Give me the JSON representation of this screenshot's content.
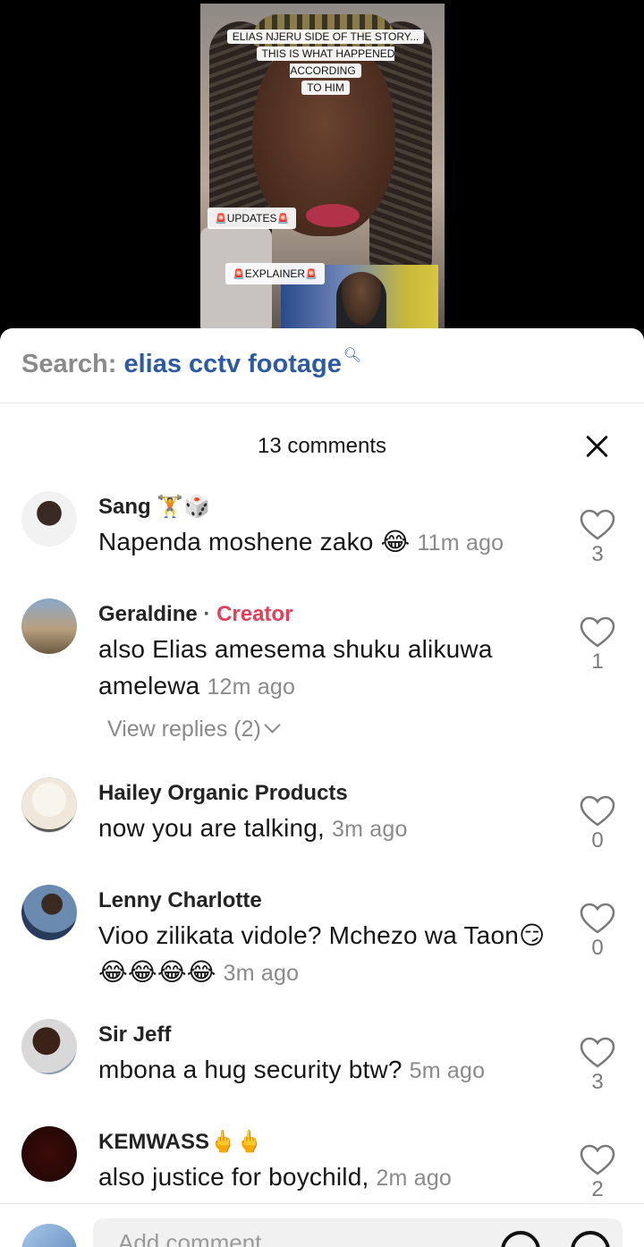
{
  "video": {
    "title_lines": [
      "ELIAS NJERU SIDE OF THE STORY...",
      "THIS IS WHAT HAPPENED ACCORDING",
      "TO HIM"
    ],
    "updates_label": "UPDATES",
    "explainer_label": "EXPLAINER",
    "siren": "🚨"
  },
  "search": {
    "prefix": "Search:",
    "term": "elias cctv footage",
    "icon": "search-icon"
  },
  "comments_header": {
    "count_label": "13 comments"
  },
  "comments": [
    {
      "name": "Sang",
      "name_extra": "🏋️🎲",
      "text": "Napenda moshene zako 😂",
      "time": "11m ago",
      "likes": "3"
    },
    {
      "name": "Geraldine",
      "badge": "Creator",
      "text": "also Elias amesema shuku alikuwa amelewa",
      "time": "12m ago",
      "likes": "1",
      "view_replies": "View replies (2)"
    },
    {
      "name": "Hailey Organic Products",
      "text": "now you are talking,",
      "time": "3m ago",
      "likes": "0"
    },
    {
      "name": "Lenny Charlotte",
      "text": "Vioo zilikata vidole? Mchezo wa Taon😏😂😂😂😂",
      "time": "3m ago",
      "likes": "0"
    },
    {
      "name": "Sir Jeff",
      "text": "mbona a hug security btw?",
      "time": "5m ago",
      "likes": "3"
    },
    {
      "name": "KEMWASS",
      "name_extra": "🖕🖕",
      "text": "also justice for boychild,",
      "time": "2m ago",
      "likes": "2"
    }
  ],
  "input": {
    "placeholder": "Add comment..."
  },
  "colors": {
    "creator": "#e0405c",
    "search_term": "#2d5aa0",
    "muted": "#8a8a8a"
  }
}
